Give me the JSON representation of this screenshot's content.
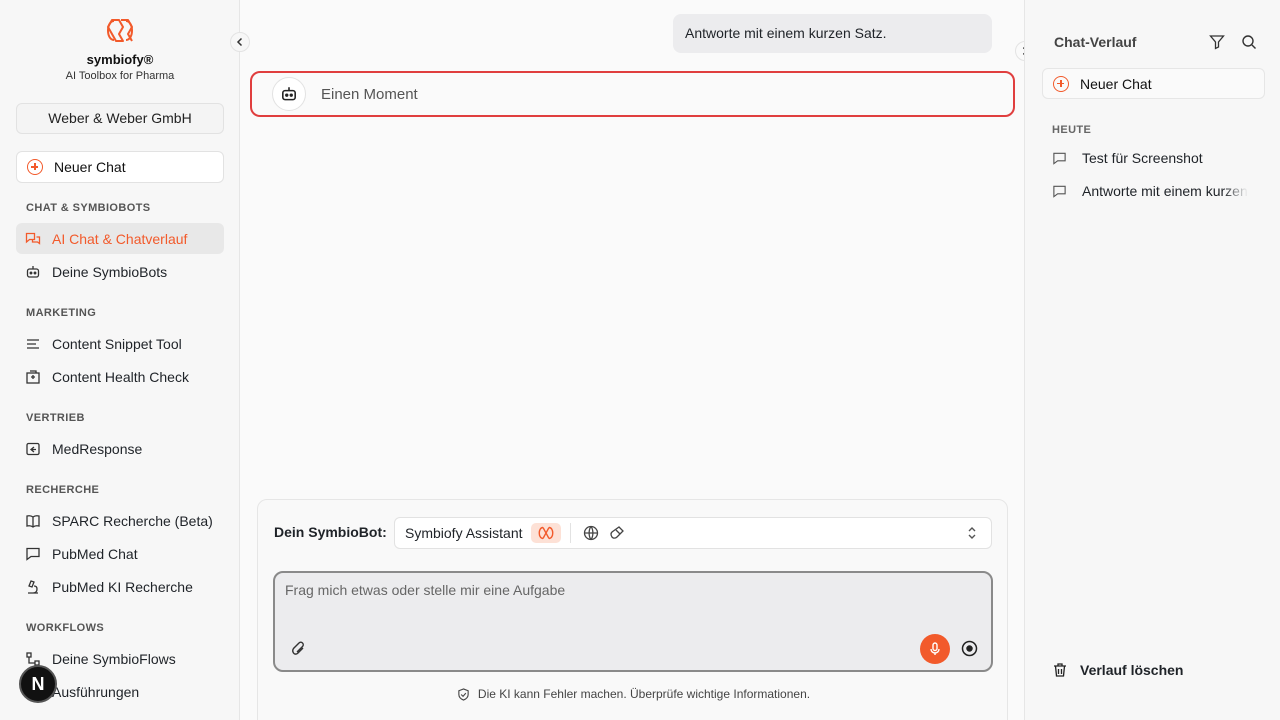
{
  "brand": {
    "name": "symbiofy®",
    "subtitle": "AI Toolbox for Pharma",
    "accent": "#f25a2b"
  },
  "org": {
    "name": "Weber & Weber GmbH"
  },
  "sidebar": {
    "new_chat_label": "Neuer Chat",
    "sections": [
      {
        "label": "CHAT & SYMBIOBOTS",
        "items": [
          {
            "label": "AI Chat & Chatverlauf",
            "icon": "chat-bubbles-icon",
            "active": true
          },
          {
            "label": "Deine SymbioBots",
            "icon": "bot-icon"
          }
        ]
      },
      {
        "label": "MARKETING",
        "items": [
          {
            "label": "Content Snippet Tool",
            "icon": "text-lines-icon"
          },
          {
            "label": "Content Health Check",
            "icon": "hospital-icon"
          }
        ]
      },
      {
        "label": "VERTRIEB",
        "items": [
          {
            "label": "MedResponse",
            "icon": "reply-icon"
          }
        ]
      },
      {
        "label": "RECHERCHE",
        "items": [
          {
            "label": "SPARC Recherche (Beta)",
            "icon": "book-icon"
          },
          {
            "label": "PubMed Chat",
            "icon": "chat-icon"
          },
          {
            "label": "PubMed KI Recherche",
            "icon": "microscope-icon"
          }
        ]
      },
      {
        "label": "WORKFLOWS",
        "items": [
          {
            "label": "Deine SymbioFlows",
            "icon": "workflow-icon"
          },
          {
            "label": "Ausführungen",
            "icon": "run-icon"
          }
        ]
      }
    ],
    "avatar_letter": "N"
  },
  "chat": {
    "user_message": "Antworte mit einem kurzen Satz.",
    "bot_message": "Einen Moment"
  },
  "composer": {
    "bot_label": "Dein SymbioBot:",
    "selected_bot": "Symbiofy Assistant",
    "placeholder": "Frag mich etwas oder stelle mir eine Aufgabe",
    "disclaimer": "Die KI kann Fehler machen. Überprüfe wichtige Informationen."
  },
  "history": {
    "title": "Chat-Verlauf",
    "new_chat_label": "Neuer Chat",
    "section_today": "HEUTE",
    "items": [
      "Test für Screenshot",
      "Antworte mit einem kurzen"
    ],
    "delete_label": "Verlauf löschen"
  }
}
